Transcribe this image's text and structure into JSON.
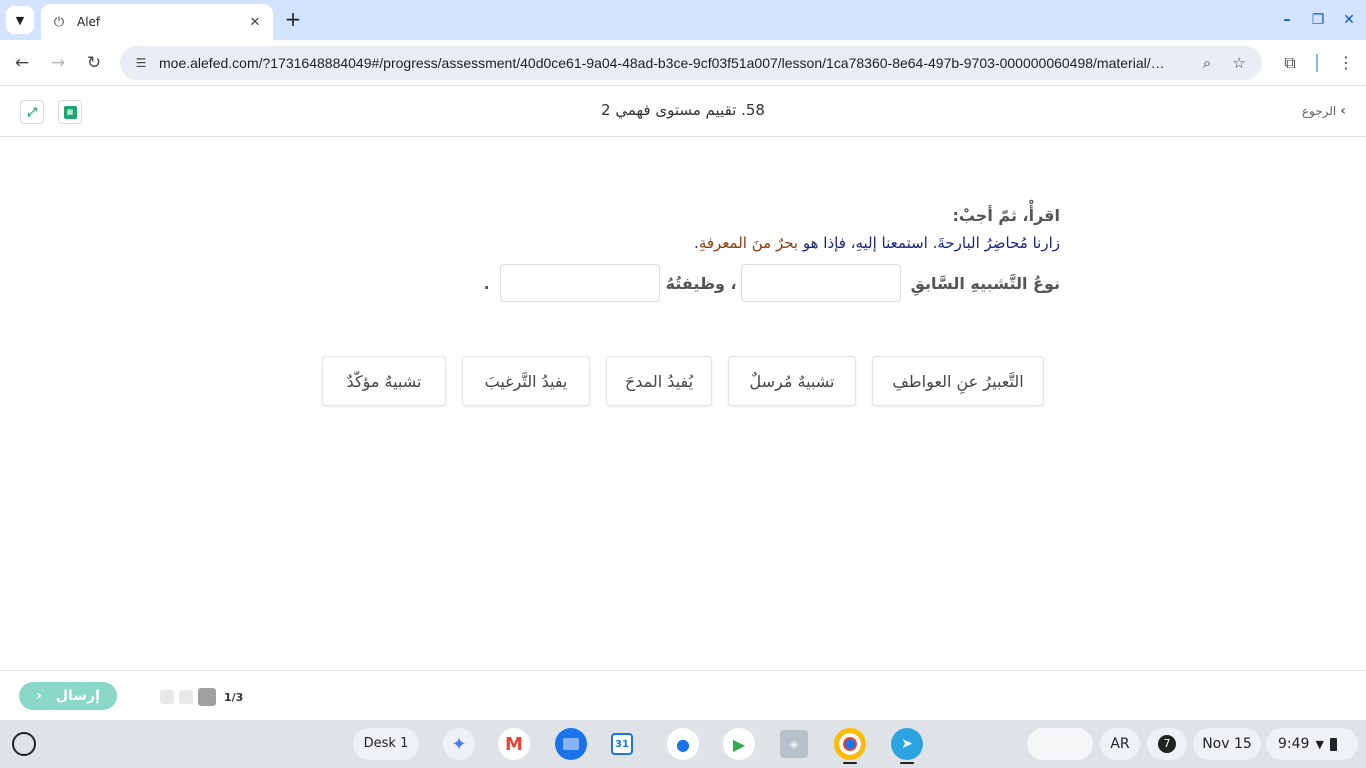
{
  "browser": {
    "tab_title": "Alef",
    "url": "moe.alefed.com/?1731648884049#/progress/assessment/40d0ce61-9a04-48ad-b3ce-9cf03f51a007/lesson/1ca78360-8e64-497b-9703-000000060498/material/…"
  },
  "header": {
    "title": "58. تقييم مستوى فهمي 2",
    "back_label": "الرجوع"
  },
  "question": {
    "instruction": "اقرأْ، ثمّ أجبْ:",
    "sentence_main": "زارنا مُحاضِرُ البارحةَ. استمعنا إليهِ، فإذا هو ",
    "sentence_highlight": "بحرٌ منَ المعرفةِ",
    "sentence_end": ".",
    "fill_label_1": "نوعُ التَّشبيهِ السَّابقِ",
    "fill_label_2": "، وظيفتُهُ",
    "fill_end": "."
  },
  "choices": [
    "التَّعبيرُ عنِ العواطفِ",
    "تشبيهٌ مُرسلٌ",
    "يُفيدُ المدحَ",
    "يفيدُ التَّرغيبَ",
    "تشبيهٌ مؤكّدٌ"
  ],
  "footer": {
    "submit_label": "إرسال",
    "page_count": "1/3"
  },
  "shelf": {
    "desk_label": "Desk 1",
    "calendar_day": "31",
    "ime_label": "AR",
    "notif_count": "7",
    "date": "Nov 15",
    "time": "9:49"
  },
  "colors": {
    "accent": "#1ea672",
    "submit_bg": "#8ad8c8",
    "sentence_text": "#1a237e",
    "highlight_text": "#8b3a12",
    "tab_strip": "#d3e3fd"
  },
  "icons": {
    "tab_search": "chevron-down-icon",
    "favicon": "alef-icon",
    "back": "arrow-left-icon",
    "forward": "arrow-right-icon",
    "reload": "reload-icon",
    "zoom": "magnifier-icon",
    "bookmark": "star-icon",
    "extensions": "puzzle-icon",
    "menu": "kebab-icon"
  }
}
